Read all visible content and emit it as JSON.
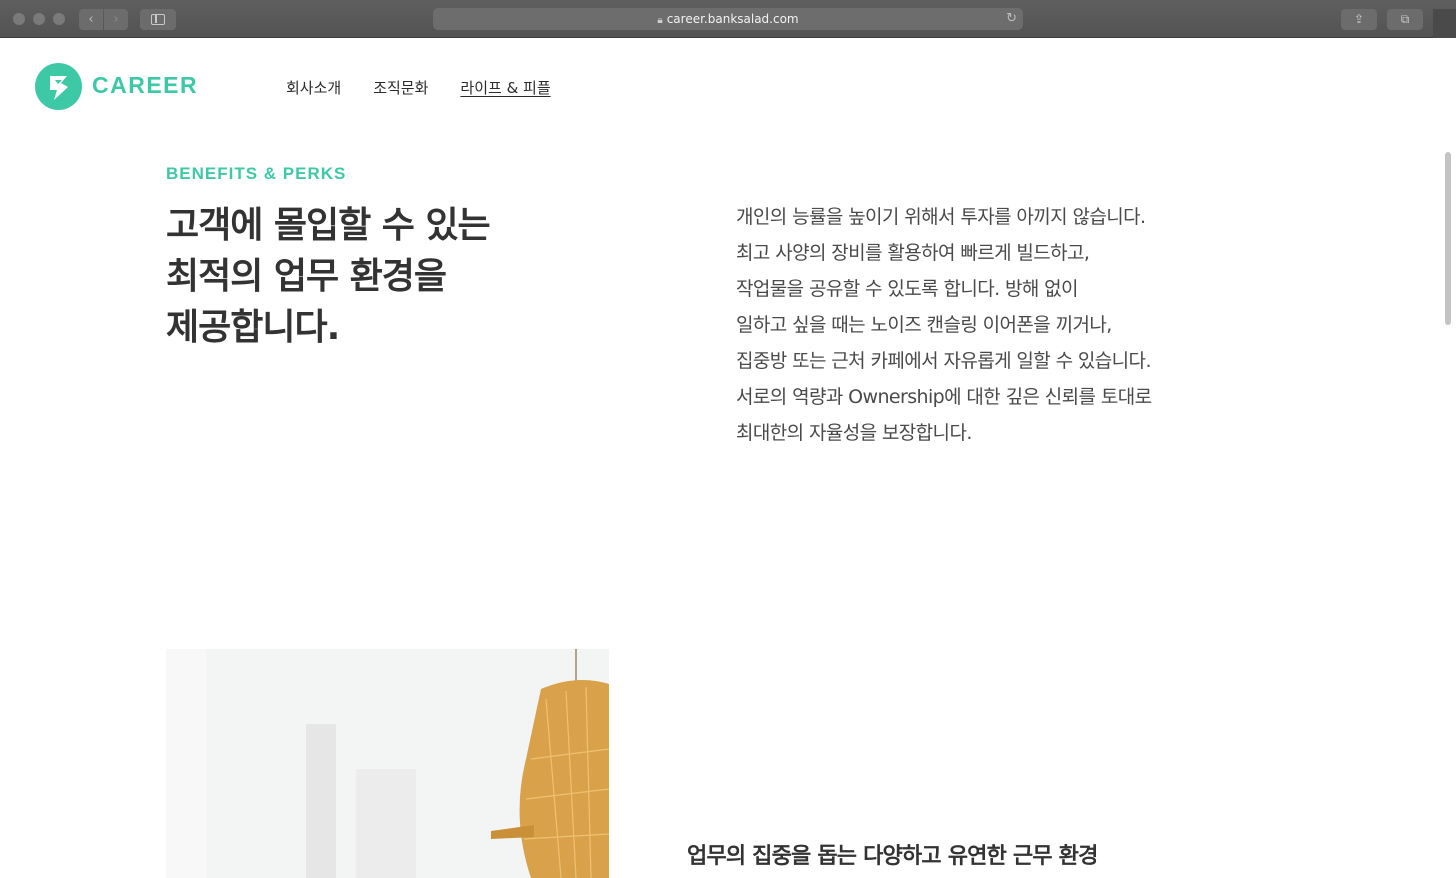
{
  "browser": {
    "url": "career.banksalad.com"
  },
  "site": {
    "logo_text": "CAREER",
    "nav": [
      {
        "label": "회사소개"
      },
      {
        "label": "조직문화"
      },
      {
        "label": "라이프 & 피플",
        "active": true
      }
    ]
  },
  "benefits": {
    "eyebrow": "BENEFITS & PERKS",
    "headline": [
      "고객에 몰입할 수 있는",
      "최적의 업무 환경을",
      "제공합니다."
    ],
    "description": [
      "개인의 능률을 높이기 위해서 투자를 아끼지 않습니다.",
      "최고 사양의 장비를 활용하여 빠르게 빌드하고,",
      "작업물을 공유할 수 있도록 합니다. 방해 없이",
      "일하고 싶을 때는 노이즈 캔슬링 이어폰을 끼거나,",
      "집중방 또는 근처 카페에서 자유롭게 일할 수 있습니다.",
      "서로의 역량과 Ownership에 대한 깊은 신뢰를 토대로",
      "최대한의 자율성을 보장합니다."
    ]
  },
  "section2": {
    "subheading": "업무의 집중을 돕는 다양하고 유연한 근무 환경"
  },
  "colors": {
    "brand": "#3ec9a6",
    "text": "#333333"
  }
}
